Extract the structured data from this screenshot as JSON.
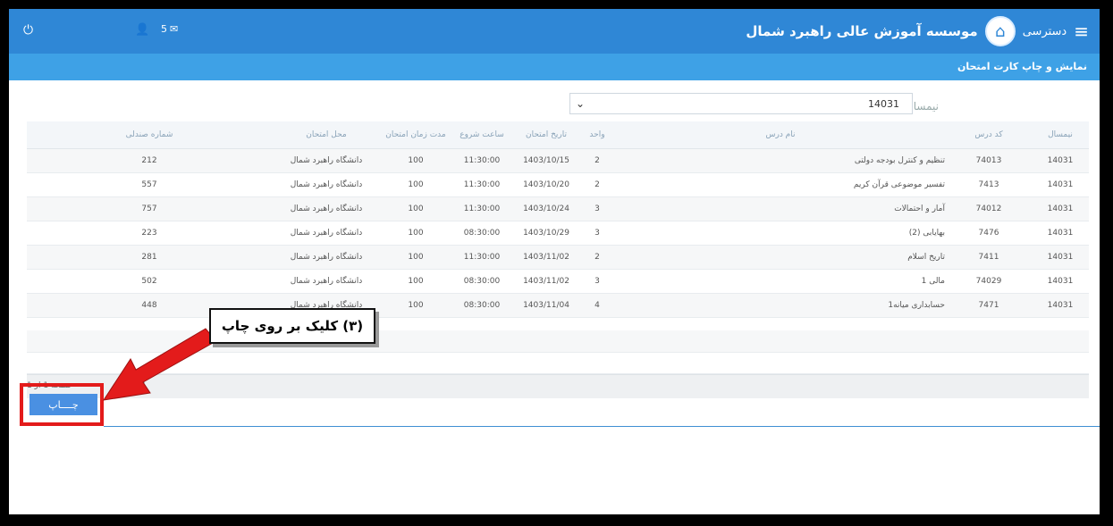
{
  "header": {
    "title": "موسسه آموزش عالی راهبرد شمال",
    "access_label": "دسترسی",
    "message_count": "5"
  },
  "subheader": {
    "page_title": "نمایش و چاپ کارت امتحان"
  },
  "filter": {
    "semester_label": "نیمسال",
    "semester_value": "14031"
  },
  "table": {
    "headers": [
      "نیمسال",
      "کد درس",
      "نام درس",
      "واحد",
      "تاریخ امتحان",
      "ساعت شروع",
      "مدت زمان امتحان",
      "محل امتحان",
      "شماره صندلی"
    ],
    "rows": [
      [
        "14031",
        "74013",
        "تنظیم و کنترل بودجه دولتی",
        "2",
        "1403/10/15",
        "11:30:00",
        "100",
        "دانشگاه راهبرد شمال",
        "212"
      ],
      [
        "14031",
        "7413",
        "تفسیر موضوعی قرآن کریم",
        "2",
        "1403/10/20",
        "11:30:00",
        "100",
        "دانشگاه راهبرد شمال",
        "557"
      ],
      [
        "14031",
        "74012",
        "آمار و احتمالات",
        "3",
        "1403/10/24",
        "11:30:00",
        "100",
        "دانشگاه راهبرد شمال",
        "757"
      ],
      [
        "14031",
        "7476",
        "بهایابی (2)",
        "3",
        "1403/10/29",
        "08:30:00",
        "100",
        "دانشگاه راهبرد شمال",
        "223"
      ],
      [
        "14031",
        "7411",
        "تاریخ اسلام",
        "2",
        "1403/11/02",
        "11:30:00",
        "100",
        "دانشگاه راهبرد شمال",
        "281"
      ],
      [
        "14031",
        "74029",
        "مالی 1",
        "3",
        "1403/11/02",
        "08:30:00",
        "100",
        "دانشگاه راهبرد شمال",
        "502"
      ],
      [
        "14031",
        "7471",
        "حسابداری میانه1",
        "4",
        "1403/11/04",
        "08:30:00",
        "100",
        "دانشگاه راهبرد شمال",
        "448"
      ]
    ]
  },
  "pager": {
    "label": "صفحه 1 از 1",
    "current": "1"
  },
  "print_button": "چــــاپ",
  "callout": "(۳) کلیک بر روی چاپ",
  "colors": {
    "header": "#2f87d6",
    "subheader": "#3ea1e6",
    "highlight": "#e31b1b",
    "button": "#4a90e2"
  }
}
